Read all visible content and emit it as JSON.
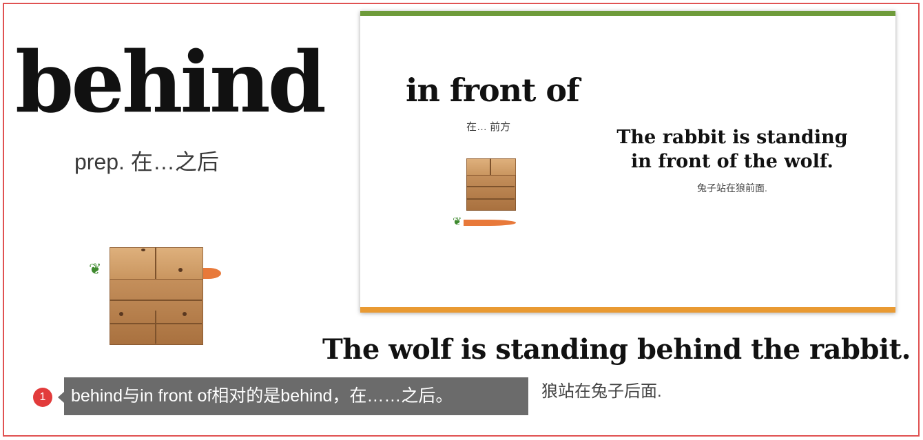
{
  "left_panel": {
    "word": "behind",
    "definition": "prep. 在…之后"
  },
  "slide": {
    "word": "in front of",
    "word_meaning": "在… 前方",
    "sentence_line1": "The rabbit is standing",
    "sentence_line2": "in front of the wolf.",
    "sentence_translation": "兔子站在狼前面.",
    "colors": {
      "top_bar": "#6e9b3a",
      "bottom_bar": "#e99a32"
    }
  },
  "main": {
    "sentence": "The wolf is standing behind the rabbit.",
    "translation": "狼站在兔子后面."
  },
  "annotation": {
    "number": "1",
    "text": "behind与in front of相对的是behind，在……之后。",
    "badge_color": "#e23b3b"
  },
  "frame_color": "#e05252"
}
